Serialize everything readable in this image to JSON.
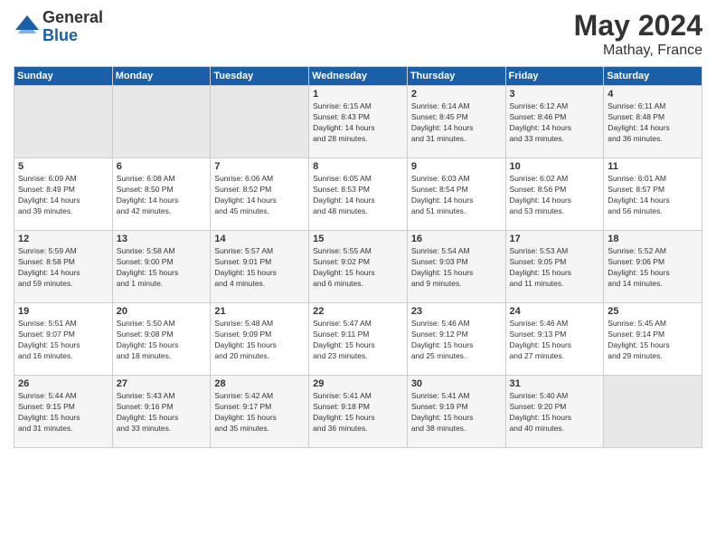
{
  "logo": {
    "general": "General",
    "blue": "Blue"
  },
  "header": {
    "month": "May 2024",
    "location": "Mathay, France"
  },
  "days_of_week": [
    "Sunday",
    "Monday",
    "Tuesday",
    "Wednesday",
    "Thursday",
    "Friday",
    "Saturday"
  ],
  "weeks": [
    [
      {
        "day": "",
        "info": ""
      },
      {
        "day": "",
        "info": ""
      },
      {
        "day": "",
        "info": ""
      },
      {
        "day": "1",
        "info": "Sunrise: 6:15 AM\nSunset: 8:43 PM\nDaylight: 14 hours\nand 28 minutes."
      },
      {
        "day": "2",
        "info": "Sunrise: 6:14 AM\nSunset: 8:45 PM\nDaylight: 14 hours\nand 31 minutes."
      },
      {
        "day": "3",
        "info": "Sunrise: 6:12 AM\nSunset: 8:46 PM\nDaylight: 14 hours\nand 33 minutes."
      },
      {
        "day": "4",
        "info": "Sunrise: 6:11 AM\nSunset: 8:48 PM\nDaylight: 14 hours\nand 36 minutes."
      }
    ],
    [
      {
        "day": "5",
        "info": "Sunrise: 6:09 AM\nSunset: 8:49 PM\nDaylight: 14 hours\nand 39 minutes."
      },
      {
        "day": "6",
        "info": "Sunrise: 6:08 AM\nSunset: 8:50 PM\nDaylight: 14 hours\nand 42 minutes."
      },
      {
        "day": "7",
        "info": "Sunrise: 6:06 AM\nSunset: 8:52 PM\nDaylight: 14 hours\nand 45 minutes."
      },
      {
        "day": "8",
        "info": "Sunrise: 6:05 AM\nSunset: 8:53 PM\nDaylight: 14 hours\nand 48 minutes."
      },
      {
        "day": "9",
        "info": "Sunrise: 6:03 AM\nSunset: 8:54 PM\nDaylight: 14 hours\nand 51 minutes."
      },
      {
        "day": "10",
        "info": "Sunrise: 6:02 AM\nSunset: 8:56 PM\nDaylight: 14 hours\nand 53 minutes."
      },
      {
        "day": "11",
        "info": "Sunrise: 6:01 AM\nSunset: 8:57 PM\nDaylight: 14 hours\nand 56 minutes."
      }
    ],
    [
      {
        "day": "12",
        "info": "Sunrise: 5:59 AM\nSunset: 8:58 PM\nDaylight: 14 hours\nand 59 minutes."
      },
      {
        "day": "13",
        "info": "Sunrise: 5:58 AM\nSunset: 9:00 PM\nDaylight: 15 hours\nand 1 minute."
      },
      {
        "day": "14",
        "info": "Sunrise: 5:57 AM\nSunset: 9:01 PM\nDaylight: 15 hours\nand 4 minutes."
      },
      {
        "day": "15",
        "info": "Sunrise: 5:55 AM\nSunset: 9:02 PM\nDaylight: 15 hours\nand 6 minutes."
      },
      {
        "day": "16",
        "info": "Sunrise: 5:54 AM\nSunset: 9:03 PM\nDaylight: 15 hours\nand 9 minutes."
      },
      {
        "day": "17",
        "info": "Sunrise: 5:53 AM\nSunset: 9:05 PM\nDaylight: 15 hours\nand 11 minutes."
      },
      {
        "day": "18",
        "info": "Sunrise: 5:52 AM\nSunset: 9:06 PM\nDaylight: 15 hours\nand 14 minutes."
      }
    ],
    [
      {
        "day": "19",
        "info": "Sunrise: 5:51 AM\nSunset: 9:07 PM\nDaylight: 15 hours\nand 16 minutes."
      },
      {
        "day": "20",
        "info": "Sunrise: 5:50 AM\nSunset: 9:08 PM\nDaylight: 15 hours\nand 18 minutes."
      },
      {
        "day": "21",
        "info": "Sunrise: 5:48 AM\nSunset: 9:09 PM\nDaylight: 15 hours\nand 20 minutes."
      },
      {
        "day": "22",
        "info": "Sunrise: 5:47 AM\nSunset: 9:11 PM\nDaylight: 15 hours\nand 23 minutes."
      },
      {
        "day": "23",
        "info": "Sunrise: 5:46 AM\nSunset: 9:12 PM\nDaylight: 15 hours\nand 25 minutes."
      },
      {
        "day": "24",
        "info": "Sunrise: 5:46 AM\nSunset: 9:13 PM\nDaylight: 15 hours\nand 27 minutes."
      },
      {
        "day": "25",
        "info": "Sunrise: 5:45 AM\nSunset: 9:14 PM\nDaylight: 15 hours\nand 29 minutes."
      }
    ],
    [
      {
        "day": "26",
        "info": "Sunrise: 5:44 AM\nSunset: 9:15 PM\nDaylight: 15 hours\nand 31 minutes."
      },
      {
        "day": "27",
        "info": "Sunrise: 5:43 AM\nSunset: 9:16 PM\nDaylight: 15 hours\nand 33 minutes."
      },
      {
        "day": "28",
        "info": "Sunrise: 5:42 AM\nSunset: 9:17 PM\nDaylight: 15 hours\nand 35 minutes."
      },
      {
        "day": "29",
        "info": "Sunrise: 5:41 AM\nSunset: 9:18 PM\nDaylight: 15 hours\nand 36 minutes."
      },
      {
        "day": "30",
        "info": "Sunrise: 5:41 AM\nSunset: 9:19 PM\nDaylight: 15 hours\nand 38 minutes."
      },
      {
        "day": "31",
        "info": "Sunrise: 5:40 AM\nSunset: 9:20 PM\nDaylight: 15 hours\nand 40 minutes."
      },
      {
        "day": "",
        "info": ""
      }
    ]
  ]
}
